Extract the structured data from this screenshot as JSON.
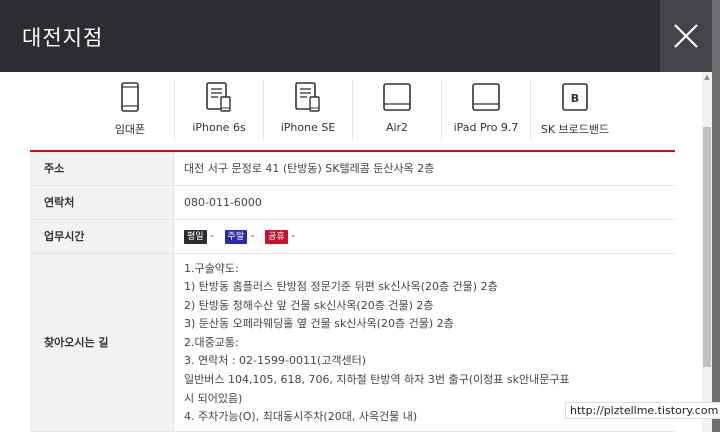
{
  "modal": {
    "title": "대전지점",
    "close_label": "×"
  },
  "devices": [
    {
      "label": "임대폰",
      "icon": "phone-icon"
    },
    {
      "label": "iPhone 6s",
      "icon": "phone-document-icon"
    },
    {
      "label": "iPhone SE",
      "icon": "phone-document-icon"
    },
    {
      "label": "Air2",
      "icon": "tablet-icon"
    },
    {
      "label": "iPad Pro 9.7",
      "icon": "tablet-icon"
    },
    {
      "label": "SK 브로드밴드",
      "icon": "broadband-b-icon"
    }
  ],
  "info": {
    "address_label": "주소",
    "address_value": "대전 서구 문정로 41 (탄방동) SK텔레콤 둔산사옥 2층",
    "phone_label": "연락처",
    "phone_value": "080-011-6000",
    "hours_label": "업무시간",
    "hours": [
      {
        "badge": "평일",
        "color": "#2d2c33",
        "value": "-"
      },
      {
        "badge": "주말",
        "color": "#2a2aa8",
        "value": "-"
      },
      {
        "badge": "공휴",
        "color": "#c8102e",
        "value": "-"
      }
    ],
    "directions_label": "찾아오시는 길",
    "directions": [
      "1.구술약도:",
      "1) 탄방동 홈플러스 탄방점 정문기준 뒤편 sk신사옥(20층 건물) 2층",
      "2) 탄방동 청해수산 앞 건물 sk신사옥(20층 건물) 2층",
      "3) 둔산동 오페라웨딩홀 옆 건물 sk신사옥(20층 건물) 2층",
      "2.대중교통:",
      "3. 연락처 : 02-1599-0011(고객센터)",
      "일반버스 104,105, 618, 706, 지하철 탄방역 하자 3번 출구(이정표 sk안내문구표",
      "시 되어있음)",
      "4. 주차가능(O), 최대동시주차(20대, 사옥건물 내)"
    ]
  },
  "watermark": "http://plztellme.tistory.com",
  "scrollbar": {
    "up_arrow": "▲"
  }
}
